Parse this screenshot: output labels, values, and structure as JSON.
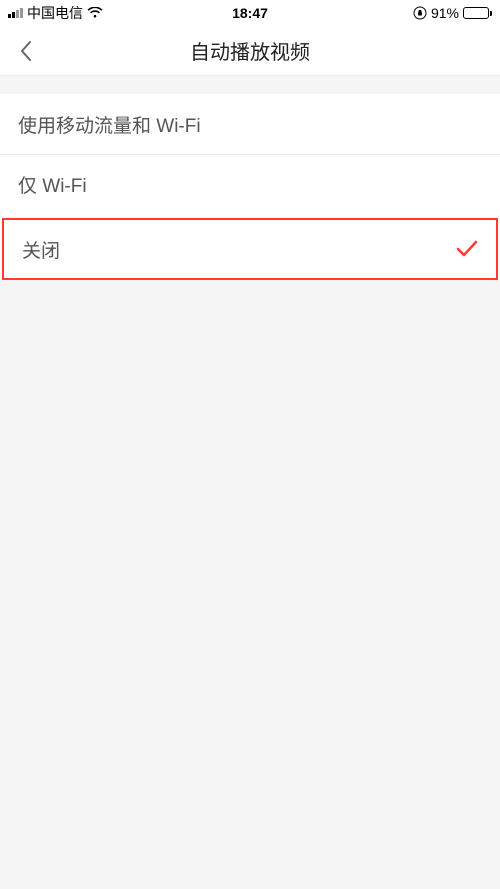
{
  "status": {
    "carrier": "中国电信",
    "time": "18:47",
    "battery_pct": "91%",
    "battery_fill_pct": 91
  },
  "nav": {
    "title": "自动播放视频"
  },
  "options": [
    {
      "label": "使用移动流量和 Wi-Fi",
      "selected": false
    },
    {
      "label": "仅 Wi-Fi",
      "selected": false
    },
    {
      "label": "关闭",
      "selected": true
    }
  ]
}
